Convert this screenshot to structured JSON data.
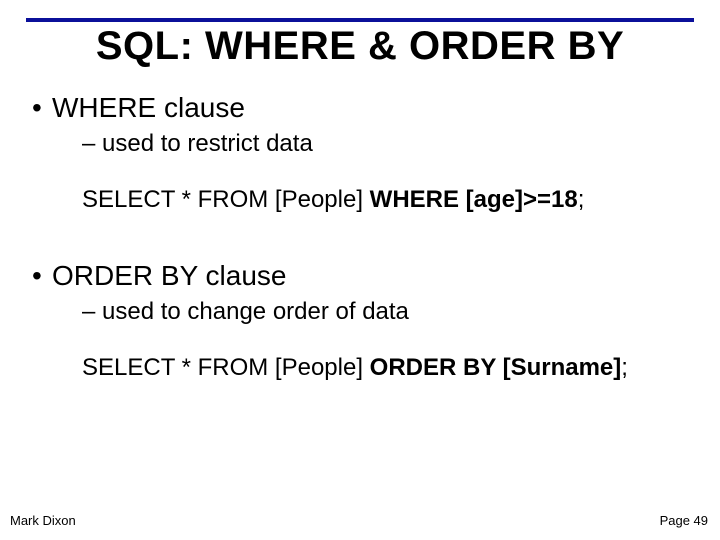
{
  "title": "SQL: WHERE & ORDER BY",
  "section1": {
    "heading": "WHERE clause",
    "sub": "– used to restrict data",
    "code_plain": "SELECT * FROM [People] ",
    "code_bold": "WHERE [age]>=18",
    "code_tail": ";"
  },
  "section2": {
    "heading": "ORDER BY clause",
    "sub": "– used to change order of data",
    "code_plain": "SELECT * FROM [People] ",
    "code_bold": "ORDER BY [Surname]",
    "code_tail": ";"
  },
  "footer": {
    "author": "Mark Dixon",
    "page": "Page 49"
  }
}
